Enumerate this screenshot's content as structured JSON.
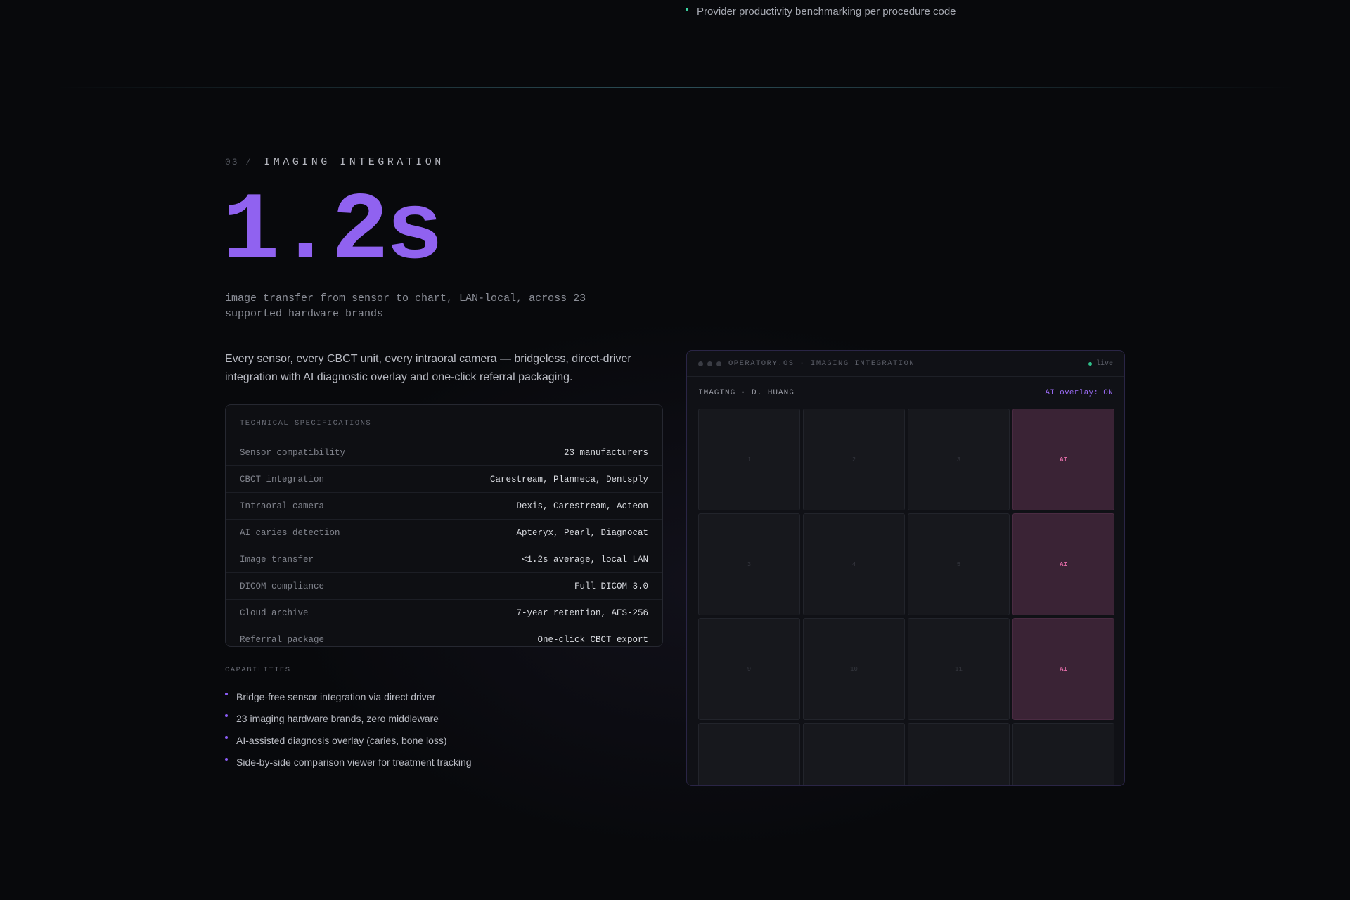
{
  "top_bullet": "Provider productivity benchmarking per procedure code",
  "section": {
    "number": "03 /",
    "title": "IMAGING INTEGRATION"
  },
  "hero": {
    "stat": "1.2s",
    "caption": "image transfer from sensor to chart, LAN-local, across 23 supported hardware brands"
  },
  "intro": "Every sensor, every CBCT unit, every intraoral camera — bridgeless, direct-driver integration with AI diagnostic overlay and one-click referral packaging.",
  "specs": {
    "header": "TECHNICAL SPECIFICATIONS",
    "rows": [
      {
        "key": "Sensor compatibility",
        "value": "23 manufacturers"
      },
      {
        "key": "CBCT integration",
        "value": "Carestream, Planmeca, Dentsply"
      },
      {
        "key": "Intraoral camera",
        "value": "Dexis, Carestream, Acteon"
      },
      {
        "key": "AI caries detection",
        "value": "Apteryx, Pearl, Diagnocat"
      },
      {
        "key": "Image transfer",
        "value": "<1.2s average, local LAN"
      },
      {
        "key": "DICOM compliance",
        "value": "Full DICOM 3.0"
      },
      {
        "key": "Cloud archive",
        "value": "7-year retention, AES-256"
      },
      {
        "key": "Referral package",
        "value": "One-click CBCT export"
      }
    ]
  },
  "capabilities": {
    "label": "CAPABILITIES",
    "items": [
      "Bridge-free sensor integration via direct driver",
      "23 imaging hardware brands, zero middleware",
      "AI-assisted diagnosis overlay (caries, bone loss)",
      "Side-by-side comparison viewer for treatment tracking"
    ]
  },
  "panel": {
    "title": "OPERATORY.OS · IMAGING INTEGRATION",
    "status": "live",
    "patient": "IMAGING · D. HUANG",
    "overlay": "AI overlay: ON",
    "tiles": [
      "1",
      "2",
      "3",
      "AI",
      "3",
      "4",
      "5",
      "AI",
      "9",
      "10",
      "11",
      "AI",
      "",
      "",
      "",
      ""
    ]
  },
  "colors": {
    "accent": "#9062f0",
    "ai_tile": "#3a2335",
    "live": "#2fbf8a"
  }
}
